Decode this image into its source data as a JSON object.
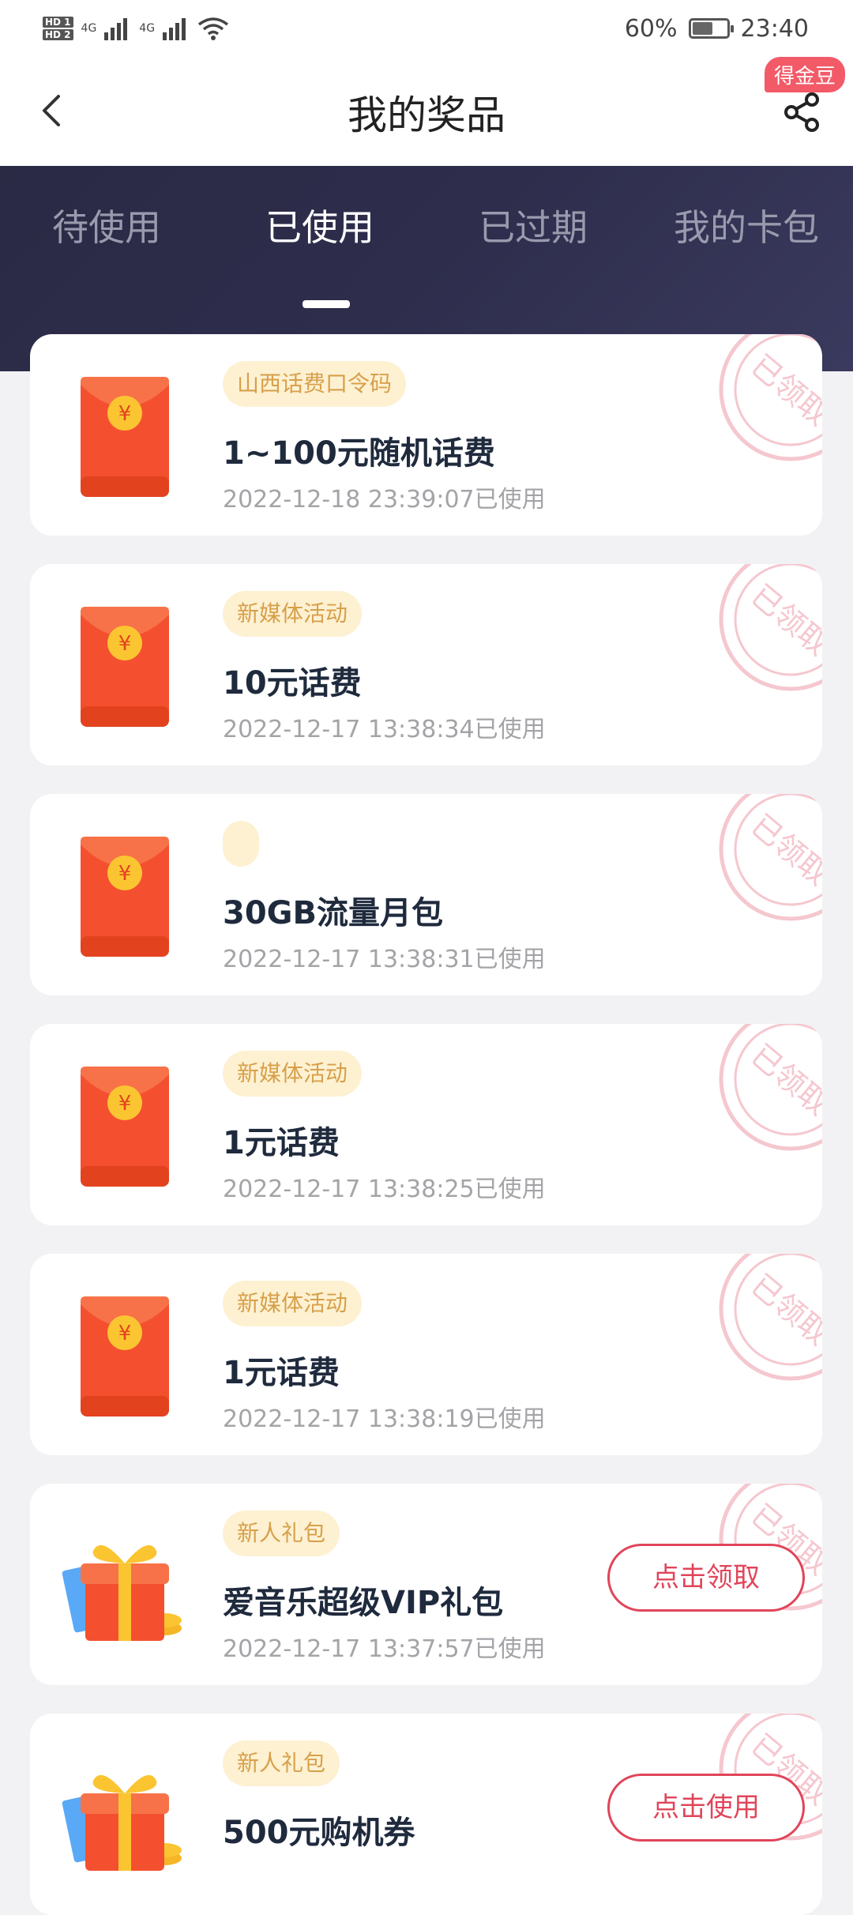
{
  "status_bar": {
    "hd1": "HD 1",
    "hd2": "HD 2",
    "net1": "4G",
    "net2": "4G",
    "battery_pct": "60%",
    "battery_level": 0.6,
    "time": "23:40"
  },
  "header": {
    "title": "我的奖品",
    "badge": "得金豆"
  },
  "tabs": [
    {
      "label": "待使用"
    },
    {
      "label": "已使用"
    },
    {
      "label": "已过期"
    },
    {
      "label": "我的卡包"
    }
  ],
  "active_tab": 1,
  "prizes": [
    {
      "tag": "山西话费口令码",
      "name": "1~100元随机话费",
      "time": "2022-12-18 23:39:07已使用",
      "icon": "red-envelope-icon"
    },
    {
      "tag": "新媒体活动",
      "name": "10元话费",
      "time": "2022-12-17 13:38:34已使用",
      "icon": "red-envelope-icon"
    },
    {
      "tag": "",
      "name": "30GB流量月包",
      "time": "2022-12-17 13:38:31已使用",
      "icon": "red-envelope-icon"
    },
    {
      "tag": "新媒体活动",
      "name": "1元话费",
      "time": "2022-12-17 13:38:25已使用",
      "icon": "red-envelope-icon"
    },
    {
      "tag": "新媒体活动",
      "name": "1元话费",
      "time": "2022-12-17 13:38:19已使用",
      "icon": "red-envelope-icon"
    },
    {
      "tag": "新人礼包",
      "name": "爱音乐超级VIP礼包",
      "time": "2022-12-17 13:37:57已使用",
      "icon": "gift-box-icon",
      "action": "点击领取"
    },
    {
      "tag": "新人礼包",
      "name": "500元购机券",
      "time": "",
      "icon": "gift-box-icon",
      "action": "点击使用"
    }
  ],
  "stamp_text": "已领取",
  "colors": {
    "accent": "#e0455a",
    "tag_bg": "#fdf1d2",
    "tag_text": "#d7a04a",
    "tab_band": "#2e2d4c"
  }
}
